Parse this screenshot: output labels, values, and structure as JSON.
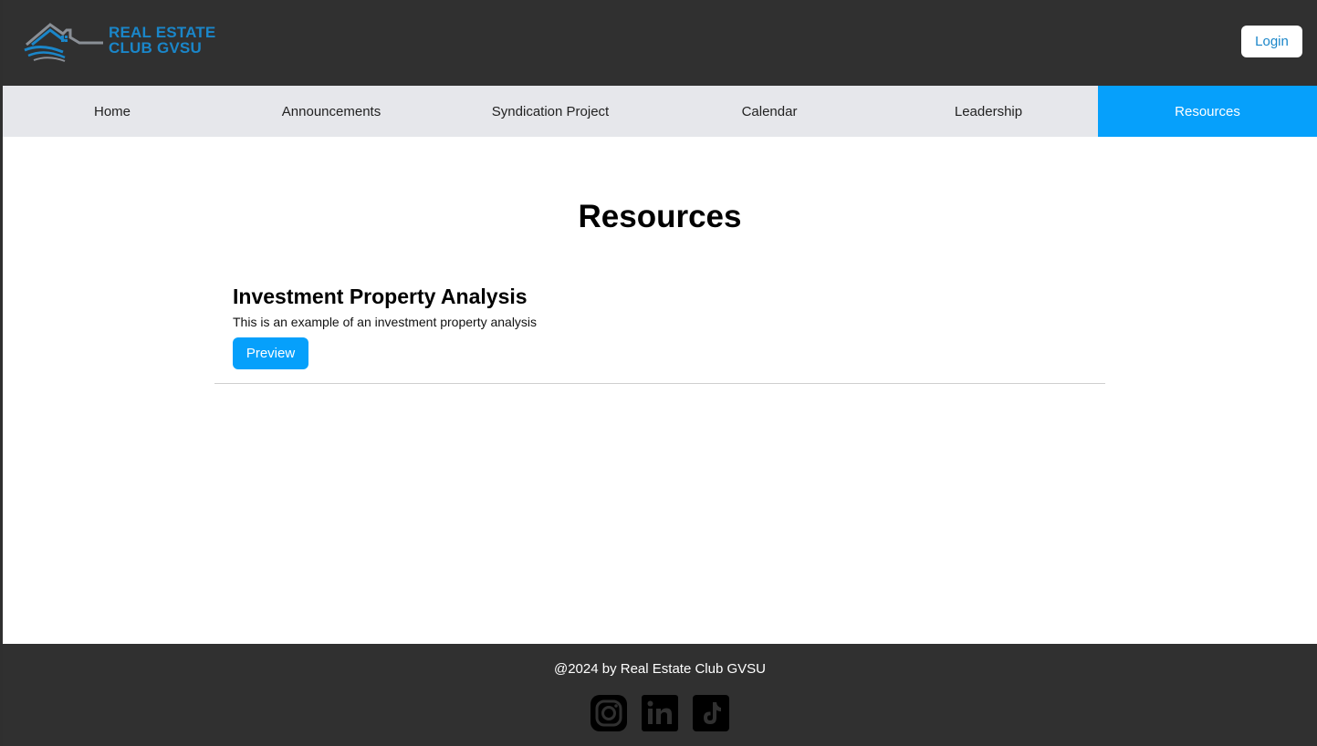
{
  "header": {
    "logo_line1": "REAL ESTATE",
    "logo_line2": "CLUB GVSU",
    "login_label": "Login"
  },
  "nav": {
    "items": [
      {
        "label": "Home"
      },
      {
        "label": "Announcements"
      },
      {
        "label": "Syndication Project"
      },
      {
        "label": "Calendar"
      },
      {
        "label": "Leadership"
      },
      {
        "label": "Resources"
      }
    ],
    "active": "Resources"
  },
  "main": {
    "title": "Resources",
    "resources": [
      {
        "title": "Investment Property Analysis",
        "description": "This is an example of an investment property analysis",
        "button_label": "Preview"
      }
    ]
  },
  "footer": {
    "copyright": "@2024 by Real Estate Club GVSU",
    "social_icons": [
      "instagram-icon",
      "linkedin-icon",
      "tiktok-icon"
    ]
  },
  "colors": {
    "accent": "#06a0fb",
    "header_bg": "#303030",
    "nav_bg": "#e6e7eb",
    "logo_blue": "#1a86c9"
  }
}
